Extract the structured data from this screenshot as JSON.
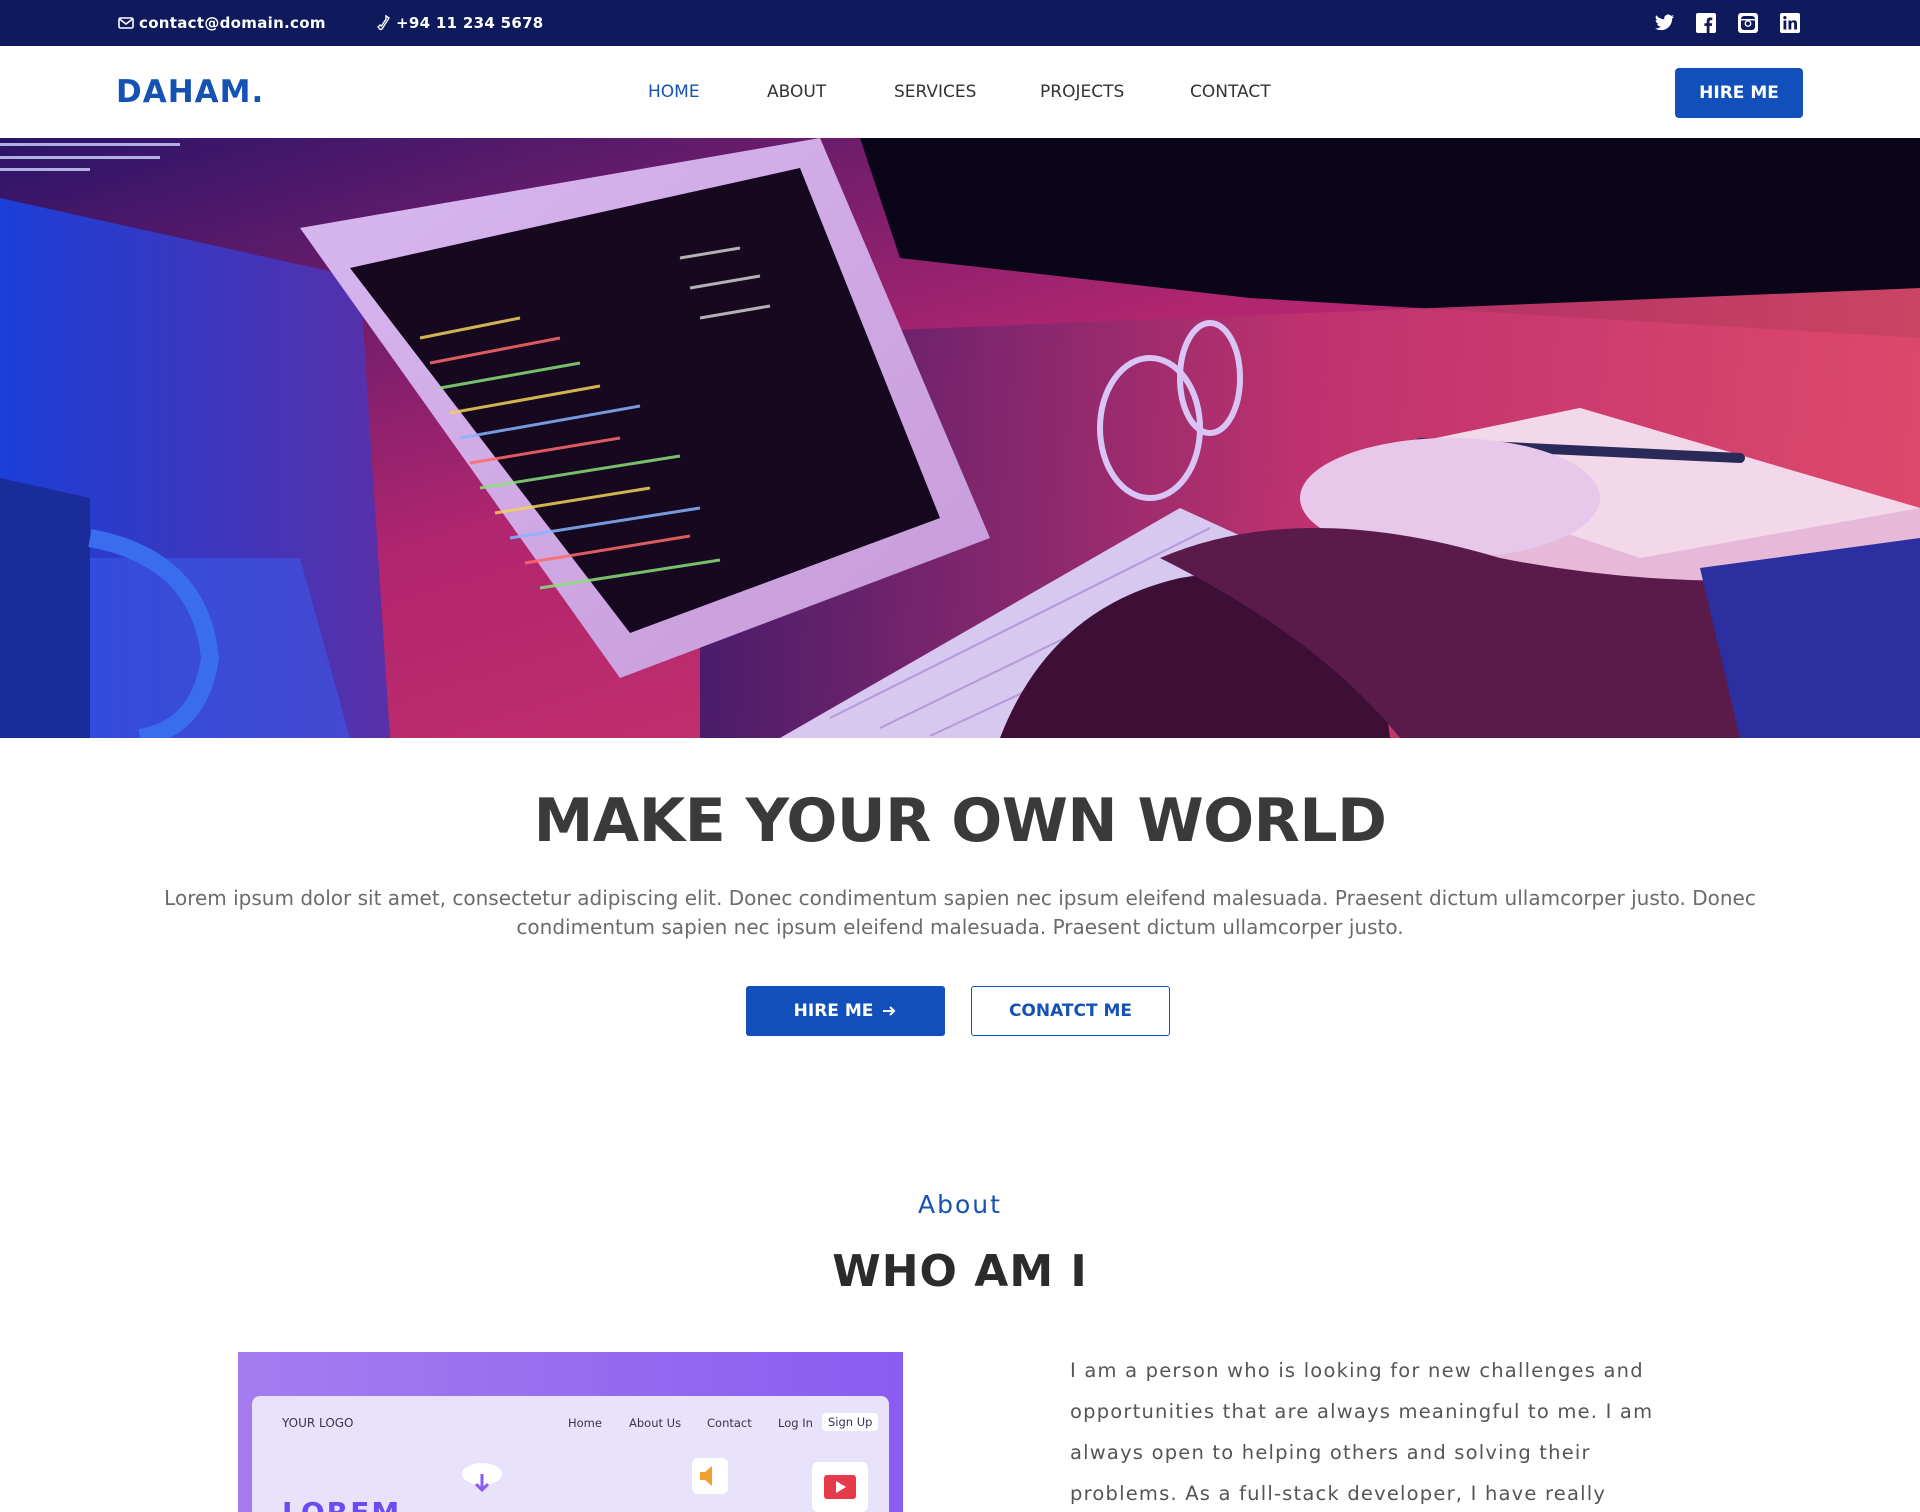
{
  "topbar": {
    "email": "contact@domain.com",
    "phone": "+94 11 234 5678",
    "socials": [
      "twitter-icon",
      "facebook-icon",
      "instagram-icon",
      "linkedin-icon"
    ]
  },
  "nav": {
    "logo": "DAHAM.",
    "items": [
      {
        "label": "HOME",
        "active": true
      },
      {
        "label": "ABOUT",
        "active": false
      },
      {
        "label": "SERVICES",
        "active": false
      },
      {
        "label": "PROJECTS",
        "active": false
      },
      {
        "label": "CONTACT",
        "active": false
      }
    ],
    "hire_button": "HIRE ME"
  },
  "hero": {
    "image_desc": "hero-photo"
  },
  "intro": {
    "headline": "MAKE YOUR OWN WORLD",
    "lead": "Lorem ipsum dolor sit amet, consectetur adipiscing elit. Donec condimentum sapien nec ipsum eleifend malesuada. Praesent dictum ullamcorper justo. Donec condimentum sapien nec ipsum eleifend malesuada. Praesent dictum ullamcorper justo.",
    "hire_button": "HIRE ME",
    "contact_button": "CONATCT ME"
  },
  "about": {
    "kicker": "About",
    "title": "WHO AM I",
    "image": {
      "logo": "YOUR LOGO",
      "links": [
        "Home",
        "About Us",
        "Contact",
        "Log In",
        "Sign Up"
      ],
      "big_text": "LOREM"
    },
    "text": "I am a person who is looking for new challenges and opportunities that are always meaningful to me. I am always open to helping others and solving their problems. As a full-stack developer, I have really enjoyed"
  },
  "colors": {
    "topbar_bg": "#0e1a5c",
    "accent": "#1150bb",
    "headline": "#3a3a3a"
  }
}
